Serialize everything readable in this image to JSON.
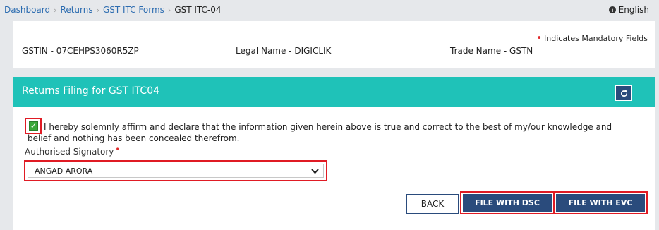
{
  "breadcrumb": {
    "items": [
      "Dashboard",
      "Returns",
      "GST ITC Forms"
    ],
    "current": "GST ITC-04"
  },
  "language": {
    "label": "English",
    "icon": "info-circle-icon"
  },
  "header_info": {
    "mandatory_note": "Indicates Mandatory Fields",
    "gstin": "GSTIN - 07CEHPS3060R5ZP",
    "legal_name": "Legal Name - DIGICLIK",
    "trade_name": "Trade Name - GSTN"
  },
  "panel": {
    "title": "Returns Filing for GST ITC04",
    "refresh_icon": "refresh-icon"
  },
  "declaration": {
    "checked": true,
    "text": "I hereby solemnly affirm and declare that the information given herein above is true and correct to the best of my/our knowledge and belief and nothing has been concealed therefrom."
  },
  "signatory": {
    "label": "Authorised Signatory",
    "selected": "ANGAD ARORA"
  },
  "buttons": {
    "back": "BACK",
    "file_dsc": "FILE WITH DSC",
    "file_evc": "FILE WITH EVC"
  },
  "colors": {
    "panel_header": "#1fc2b8",
    "button_blue": "#2a4b7c",
    "highlight_red": "#e01b24",
    "link_blue": "#2c6cb0"
  }
}
